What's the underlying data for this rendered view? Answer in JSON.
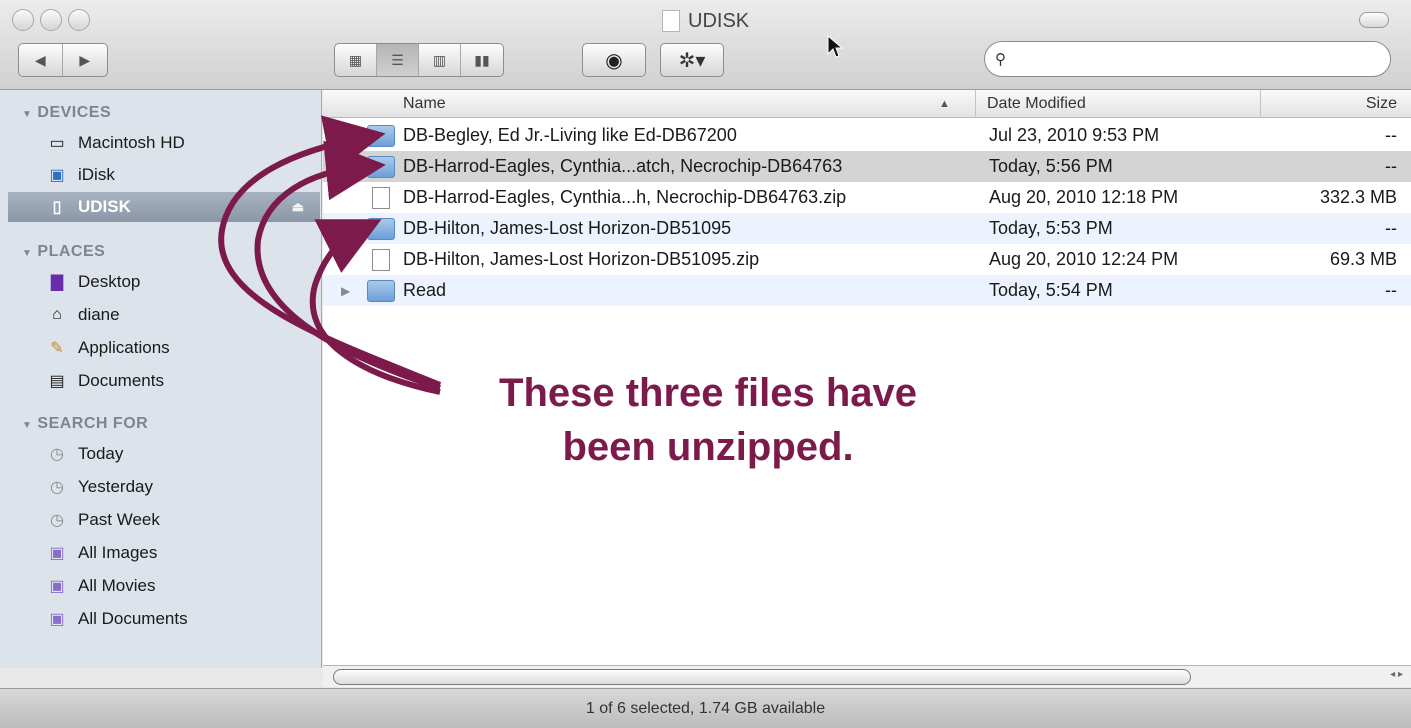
{
  "window": {
    "title": "UDISK"
  },
  "toolbar": {
    "back_icon": "left-arrow-icon",
    "forward_icon": "right-arrow-icon",
    "view_modes": [
      "icon-view-icon",
      "list-view-icon",
      "column-view-icon",
      "coverflow-view-icon"
    ],
    "active_view": "list-view-icon",
    "quicklook_icon": "eye-icon",
    "action_icon": "gear-icon",
    "search": {
      "value": "",
      "placeholder": ""
    }
  },
  "sidebar": {
    "devices_label": "DEVICES",
    "devices": [
      {
        "label": "Macintosh HD",
        "icon": "hard-drive-icon"
      },
      {
        "label": "iDisk",
        "icon": "idisk-icon"
      },
      {
        "label": "UDISK",
        "icon": "usb-disk-icon",
        "selected": true
      }
    ],
    "places_label": "PLACES",
    "places": [
      {
        "label": "Desktop",
        "icon": "desktop-icon"
      },
      {
        "label": "diane",
        "icon": "home-icon"
      },
      {
        "label": "Applications",
        "icon": "applications-icon"
      },
      {
        "label": "Documents",
        "icon": "documents-icon"
      }
    ],
    "search_label": "SEARCH FOR",
    "searches": [
      {
        "label": "Today",
        "icon": "clock-icon"
      },
      {
        "label": "Yesterday",
        "icon": "clock-icon"
      },
      {
        "label": "Past Week",
        "icon": "clock-icon"
      },
      {
        "label": "All Images",
        "icon": "smart-folder-icon"
      },
      {
        "label": "All Movies",
        "icon": "smart-folder-icon"
      },
      {
        "label": "All Documents",
        "icon": "smart-folder-icon"
      }
    ]
  },
  "columns": {
    "name": "Name",
    "date": "Date Modified",
    "size": "Size"
  },
  "files": [
    {
      "name": "DB-Begley, Ed Jr.-Living like Ed-DB67200",
      "date": "Jul 23, 2010 9:53 PM",
      "size": "--",
      "type": "folder"
    },
    {
      "name": "DB-Harrod-Eagles, Cynthia...atch, Necrochip-DB64763",
      "date": "Today, 5:56 PM",
      "size": "--",
      "type": "folder"
    },
    {
      "name": "DB-Harrod-Eagles, Cynthia...h, Necrochip-DB64763.zip",
      "date": "Aug 20, 2010 12:18 PM",
      "size": "332.3 MB",
      "type": "zip"
    },
    {
      "name": "DB-Hilton, James-Lost Horizon-DB51095",
      "date": "Today, 5:53 PM",
      "size": "--",
      "type": "folder"
    },
    {
      "name": "DB-Hilton, James-Lost Horizon-DB51095.zip",
      "date": "Aug 20, 2010 12:24 PM",
      "size": "69.3 MB",
      "type": "zip"
    },
    {
      "name": "Read",
      "date": "Today, 5:54 PM",
      "size": "--",
      "type": "folder"
    }
  ],
  "status": "1 of 6 selected, 1.74 GB available",
  "annotation": {
    "line1": "These three files have",
    "line2": "been unzipped.",
    "color": "#7c1a4b"
  }
}
